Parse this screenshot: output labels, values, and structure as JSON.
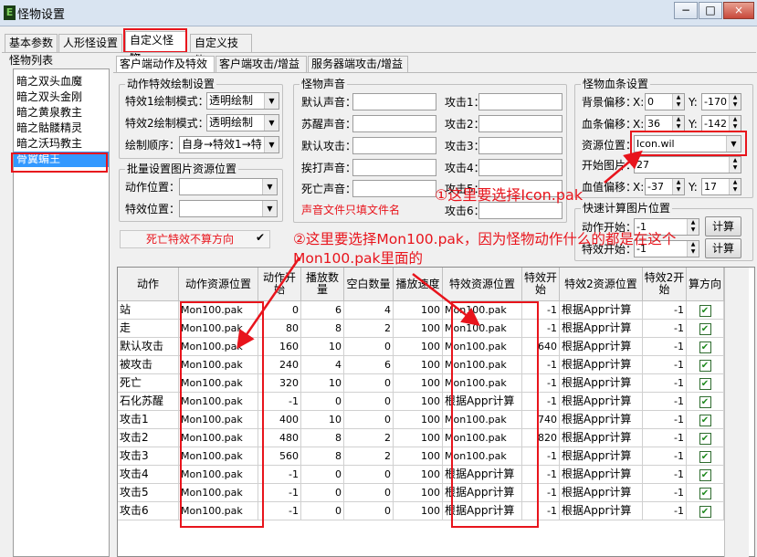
{
  "window": {
    "title": "怪物设置",
    "app_icon": "E",
    "minimize": "−",
    "maximize": "□",
    "close": "×"
  },
  "tabs": [
    "基本参数",
    "人形怪设置",
    "自定义怪物",
    "自定义技能"
  ],
  "subtabs": [
    "客户端动作及特效",
    "客户端攻击/增益",
    "服务器端攻击/增益"
  ],
  "monster_list": {
    "title": "怪物列表",
    "items": [
      "暗之双头血魔",
      "暗之双头金刚",
      "暗之黄泉教主",
      "暗之骷髅精灵",
      "暗之沃玛教主",
      "骨翼蝙王"
    ],
    "selected_index": 5
  },
  "effect_settings": {
    "title": "动作特效绘制设置",
    "effect1_label": "特效1绘制模式：",
    "effect1_value": "透明绘制",
    "effect2_label": "特效2绘制模式：",
    "effect2_value": "透明绘制",
    "order_label": "绘制顺序：",
    "order_value": "自身→特效1→特"
  },
  "batch_settings": {
    "title": "批量设置图片资源位置",
    "action_label": "动作位置：",
    "action_value": "",
    "effect_label": "特效位置：",
    "effect_value": ""
  },
  "death_effect": {
    "label": "死亡特效不算方向",
    "checked": true
  },
  "sounds": {
    "title": "怪物声音",
    "left": [
      {
        "label": "默认声音：",
        "value": ""
      },
      {
        "label": "苏醒声音：",
        "value": ""
      },
      {
        "label": "默认攻击：",
        "value": ""
      },
      {
        "label": "挨打声音：",
        "value": ""
      },
      {
        "label": "死亡声音：",
        "value": ""
      }
    ],
    "right": [
      {
        "label": "攻击1：",
        "value": ""
      },
      {
        "label": "攻击2：",
        "value": ""
      },
      {
        "label": "攻击3：",
        "value": ""
      },
      {
        "label": "攻击4：",
        "value": ""
      },
      {
        "label": "攻击5：",
        "value": ""
      },
      {
        "label": "攻击6：",
        "value": ""
      }
    ],
    "note": "声音文件只填文件名"
  },
  "bloodbar": {
    "title": "怪物血条设置",
    "bg_offset_label": "背景偏移：",
    "bg_x": "0",
    "bg_y": "-170",
    "bar_offset_label": "血条偏移：",
    "bar_x": "36",
    "bar_y": "-142",
    "resource_label": "资源位置：",
    "resource_value": "Icon.wil",
    "start_label": "开始图片：",
    "start_value": "27",
    "hp_offset_label": "血值偏移：",
    "hp_x": "-37",
    "hp_y": "17",
    "x_label": "X:",
    "y_label": "Y:"
  },
  "quick_calc": {
    "title": "快速计算图片位置",
    "action_label": "动作开始：",
    "action_value": "-1",
    "effect_label": "特效开始：",
    "effect_value": "-1",
    "calc_button": "计算"
  },
  "annotations": {
    "one": "①这里要选择Icon.pak",
    "two_line1": "②这里要选择Mon100.pak，因为怪物动作什么的都是在这个",
    "two_line2": "Mon100.pak里面的"
  },
  "table": {
    "headers": [
      "动作",
      "动作资源位置",
      "动作开始",
      "播放数量",
      "空白数量",
      "播放速度",
      "特效资源位置",
      "特效开始",
      "特效2资源位置",
      "特效2开始",
      "算方向"
    ],
    "rows": [
      [
        "站",
        "Mon100.pak",
        "0",
        "6",
        "4",
        "100",
        "Mon100.pak",
        "-1",
        "根据Appr计算",
        "-1",
        true
      ],
      [
        "走",
        "Mon100.pak",
        "80",
        "8",
        "2",
        "100",
        "Mon100.pak",
        "-1",
        "根据Appr计算",
        "-1",
        true
      ],
      [
        "默认攻击",
        "Mon100.pak",
        "160",
        "10",
        "0",
        "100",
        "Mon100.pak",
        "640",
        "根据Appr计算",
        "-1",
        true
      ],
      [
        "被攻击",
        "Mon100.pak",
        "240",
        "4",
        "6",
        "100",
        "Mon100.pak",
        "-1",
        "根据Appr计算",
        "-1",
        true
      ],
      [
        "死亡",
        "Mon100.pak",
        "320",
        "10",
        "0",
        "100",
        "Mon100.pak",
        "-1",
        "根据Appr计算",
        "-1",
        true
      ],
      [
        "石化苏醒",
        "Mon100.pak",
        "-1",
        "0",
        "0",
        "100",
        "根据Appr计算",
        "-1",
        "根据Appr计算",
        "-1",
        true
      ],
      [
        "攻击1",
        "Mon100.pak",
        "400",
        "10",
        "0",
        "100",
        "Mon100.pak",
        "740",
        "根据Appr计算",
        "-1",
        true
      ],
      [
        "攻击2",
        "Mon100.pak",
        "480",
        "8",
        "2",
        "100",
        "Mon100.pak",
        "820",
        "根据Appr计算",
        "-1",
        true
      ],
      [
        "攻击3",
        "Mon100.pak",
        "560",
        "8",
        "2",
        "100",
        "Mon100.pak",
        "-1",
        "根据Appr计算",
        "-1",
        true
      ],
      [
        "攻击4",
        "Mon100.pak",
        "-1",
        "0",
        "0",
        "100",
        "根据Appr计算",
        "-1",
        "根据Appr计算",
        "-1",
        true
      ],
      [
        "攻击5",
        "Mon100.pak",
        "-1",
        "0",
        "0",
        "100",
        "根据Appr计算",
        "-1",
        "根据Appr计算",
        "-1",
        true
      ],
      [
        "攻击6",
        "Mon100.pak",
        "-1",
        "0",
        "0",
        "100",
        "根据Appr计算",
        "-1",
        "根据Appr计算",
        "-1",
        true
      ]
    ]
  },
  "colors": {
    "annotation": "#e8141c",
    "selection": "#3399ff",
    "title_bar": "#d9e4f1"
  }
}
